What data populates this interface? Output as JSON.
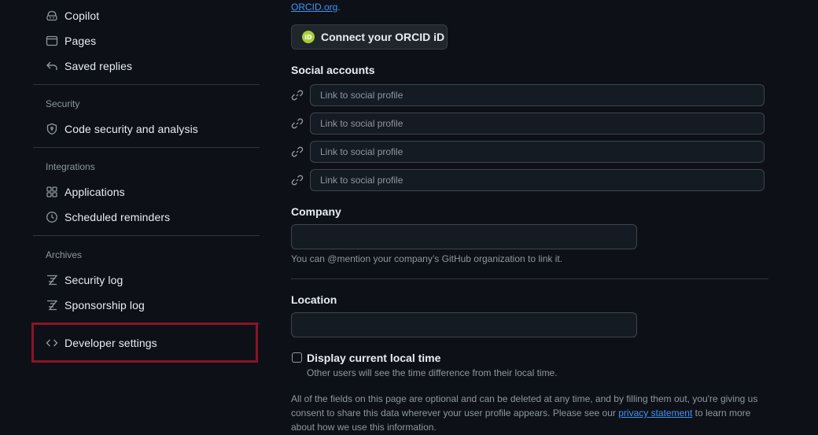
{
  "sidebar": {
    "items_top": [
      {
        "label": "Copilot",
        "icon": "copilot-icon"
      },
      {
        "label": "Pages",
        "icon": "browser-icon"
      },
      {
        "label": "Saved replies",
        "icon": "reply-icon"
      }
    ],
    "security": {
      "heading": "Security",
      "items": [
        {
          "label": "Code security and analysis",
          "icon": "shield-icon"
        }
      ]
    },
    "integrations": {
      "heading": "Integrations",
      "items": [
        {
          "label": "Applications",
          "icon": "apps-icon"
        },
        {
          "label": "Scheduled reminders",
          "icon": "clock-icon"
        }
      ]
    },
    "archives": {
      "heading": "Archives",
      "items": [
        {
          "label": "Security log",
          "icon": "log-icon"
        },
        {
          "label": "Sponsorship log",
          "icon": "log-icon"
        }
      ]
    },
    "developer": {
      "label": "Developer settings",
      "icon": "code-icon"
    }
  },
  "main": {
    "orcid_link_text": "ORCID.org",
    "orcid_link_suffix": ".",
    "orcid_button": {
      "label": "Connect your ORCID iD",
      "badge": "iD"
    },
    "social": {
      "label": "Social accounts",
      "placeholders": [
        "Link to social profile",
        "Link to social profile",
        "Link to social profile",
        "Link to social profile"
      ]
    },
    "company": {
      "label": "Company",
      "value": "",
      "hint": "You can @mention your company’s GitHub organization to link it."
    },
    "location": {
      "label": "Location",
      "value": ""
    },
    "local_time": {
      "label": "Display current local time",
      "hint": "Other users will see the time difference from their local time.",
      "checked": false
    },
    "footer": {
      "before": "All of the fields on this page are optional and can be deleted at any time, and by filling them out, you're giving us consent to share this data wherever your user profile appears. Please see our ",
      "link": "privacy statement",
      "after": " to learn more about how we use this information."
    }
  },
  "colors": {
    "background": "#0d1117",
    "border": "#30363d",
    "link": "#4493f8",
    "highlight": "#8b1427"
  }
}
